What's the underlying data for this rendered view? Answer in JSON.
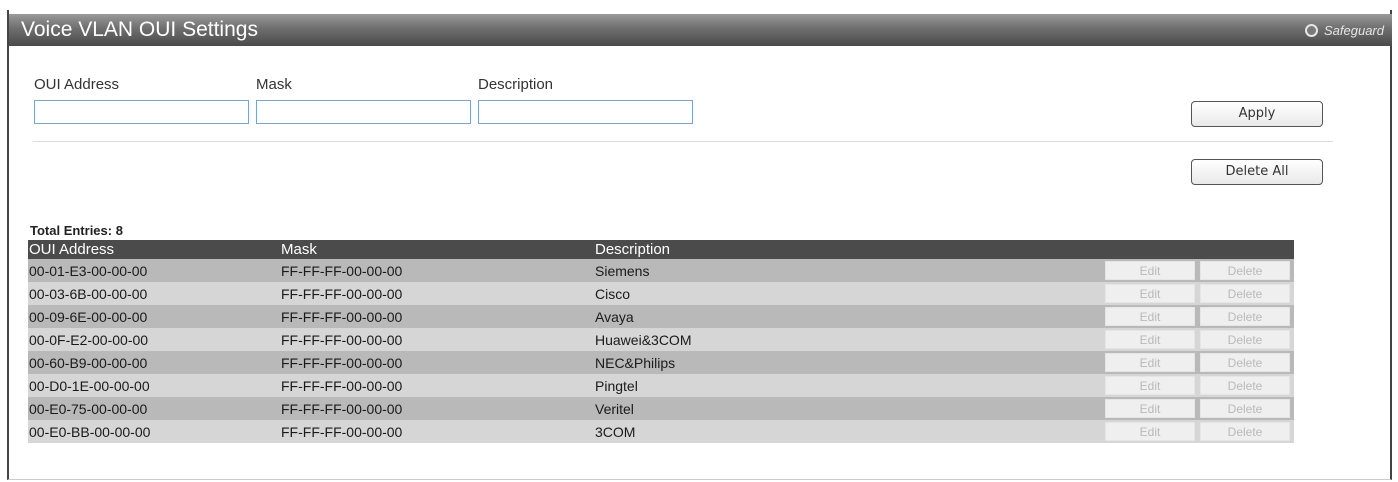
{
  "header": {
    "title": "Voice VLAN OUI Settings",
    "safeguard_label": "Safeguard"
  },
  "form": {
    "oui_label": "OUI Address",
    "mask_label": "Mask",
    "description_label": "Description",
    "oui_value": "",
    "mask_value": "",
    "description_value": "",
    "apply_label": "Apply",
    "delete_all_label": "Delete All"
  },
  "summary": {
    "total_entries": "Total Entries: 8"
  },
  "table": {
    "columns": [
      "OUI Address",
      "Mask",
      "Description"
    ],
    "edit_label": "Edit",
    "delete_label": "Delete",
    "rows": [
      {
        "oui": "00-01-E3-00-00-00",
        "mask": "FF-FF-FF-00-00-00",
        "description": "Siemens"
      },
      {
        "oui": "00-03-6B-00-00-00",
        "mask": "FF-FF-FF-00-00-00",
        "description": "Cisco"
      },
      {
        "oui": "00-09-6E-00-00-00",
        "mask": "FF-FF-FF-00-00-00",
        "description": "Avaya"
      },
      {
        "oui": "00-0F-E2-00-00-00",
        "mask": "FF-FF-FF-00-00-00",
        "description": "Huawei&3COM"
      },
      {
        "oui": "00-60-B9-00-00-00",
        "mask": "FF-FF-FF-00-00-00",
        "description": "NEC&Philips"
      },
      {
        "oui": "00-D0-1E-00-00-00",
        "mask": "FF-FF-FF-00-00-00",
        "description": "Pingtel"
      },
      {
        "oui": "00-E0-75-00-00-00",
        "mask": "FF-FF-FF-00-00-00",
        "description": "Veritel"
      },
      {
        "oui": "00-E0-BB-00-00-00",
        "mask": "FF-FF-FF-00-00-00",
        "description": "3COM"
      }
    ]
  },
  "colors": {
    "title_bar": "#6e6e6e",
    "table_header": "#4b4b4b",
    "row_odd": "#b9b9b9",
    "row_even": "#d6d6d6",
    "input_border": "#7fa3c6"
  }
}
